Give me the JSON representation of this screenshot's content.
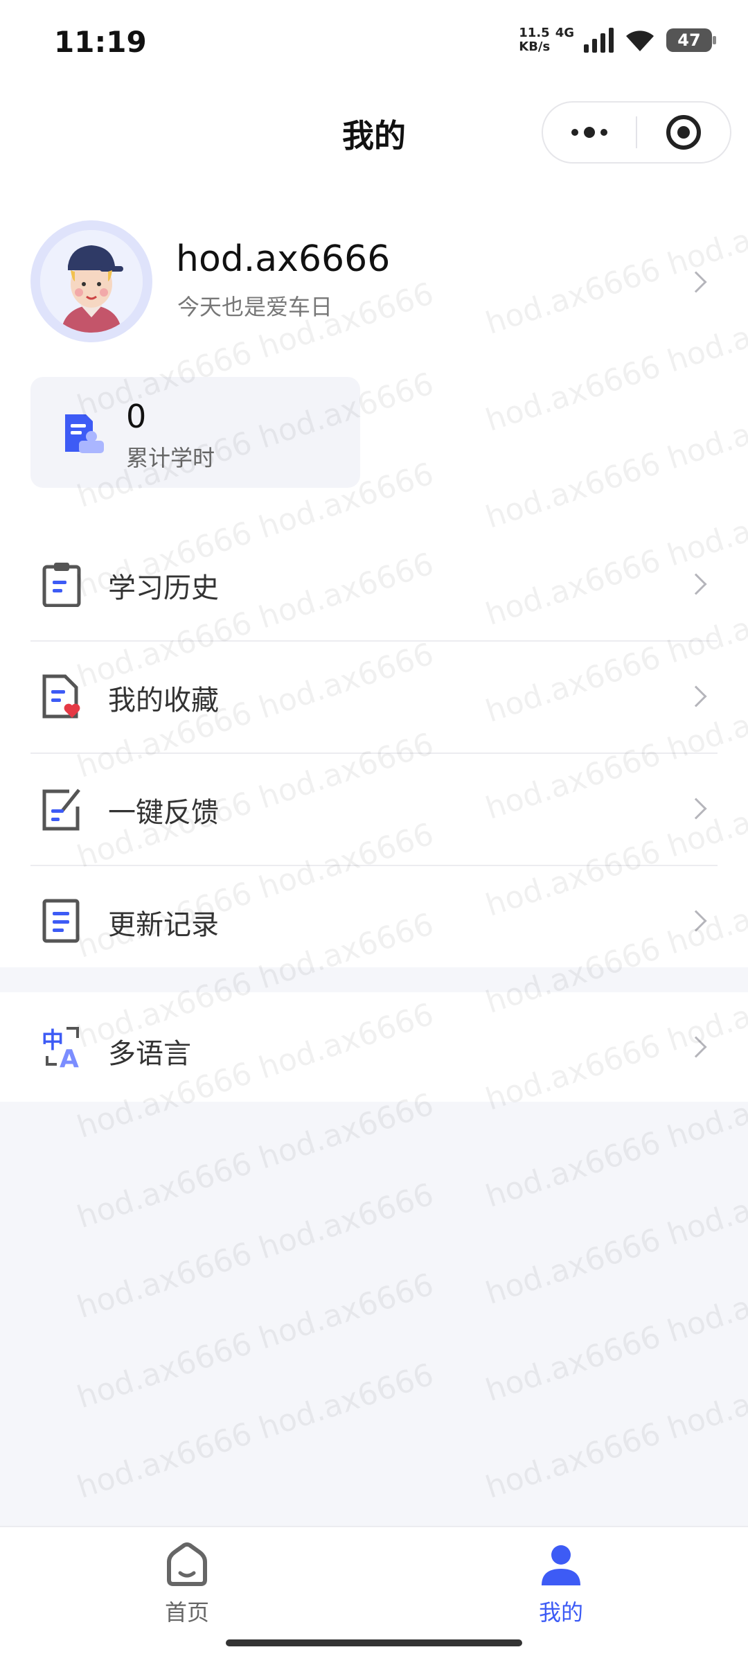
{
  "status_bar": {
    "time": "11:19",
    "net_speed_value": "11.5",
    "net_type": "4G",
    "net_speed_unit": "KB/s",
    "battery": "47"
  },
  "nav": {
    "title": "我的"
  },
  "profile": {
    "username": "hod.ax6666",
    "slogan": "今天也是爱车日"
  },
  "stats": {
    "value": "0",
    "label": "累计学时"
  },
  "menu": {
    "items": [
      {
        "label": "学习历史",
        "icon": "clipboard-icon"
      },
      {
        "label": "我的收藏",
        "icon": "favorite-document-icon"
      },
      {
        "label": "一键反馈",
        "icon": "feedback-edit-icon"
      },
      {
        "label": "更新记录",
        "icon": "update-log-icon"
      }
    ],
    "language": {
      "label": "多语言",
      "icon": "translate-icon"
    }
  },
  "watermark_text": "hod.ax6666 hod.ax6666",
  "tabs": [
    {
      "label": "首页",
      "icon": "home-icon"
    },
    {
      "label": "我的",
      "icon": "person-icon"
    }
  ],
  "colors": {
    "accent": "#3d5bf5",
    "background": "#f5f6fa"
  }
}
